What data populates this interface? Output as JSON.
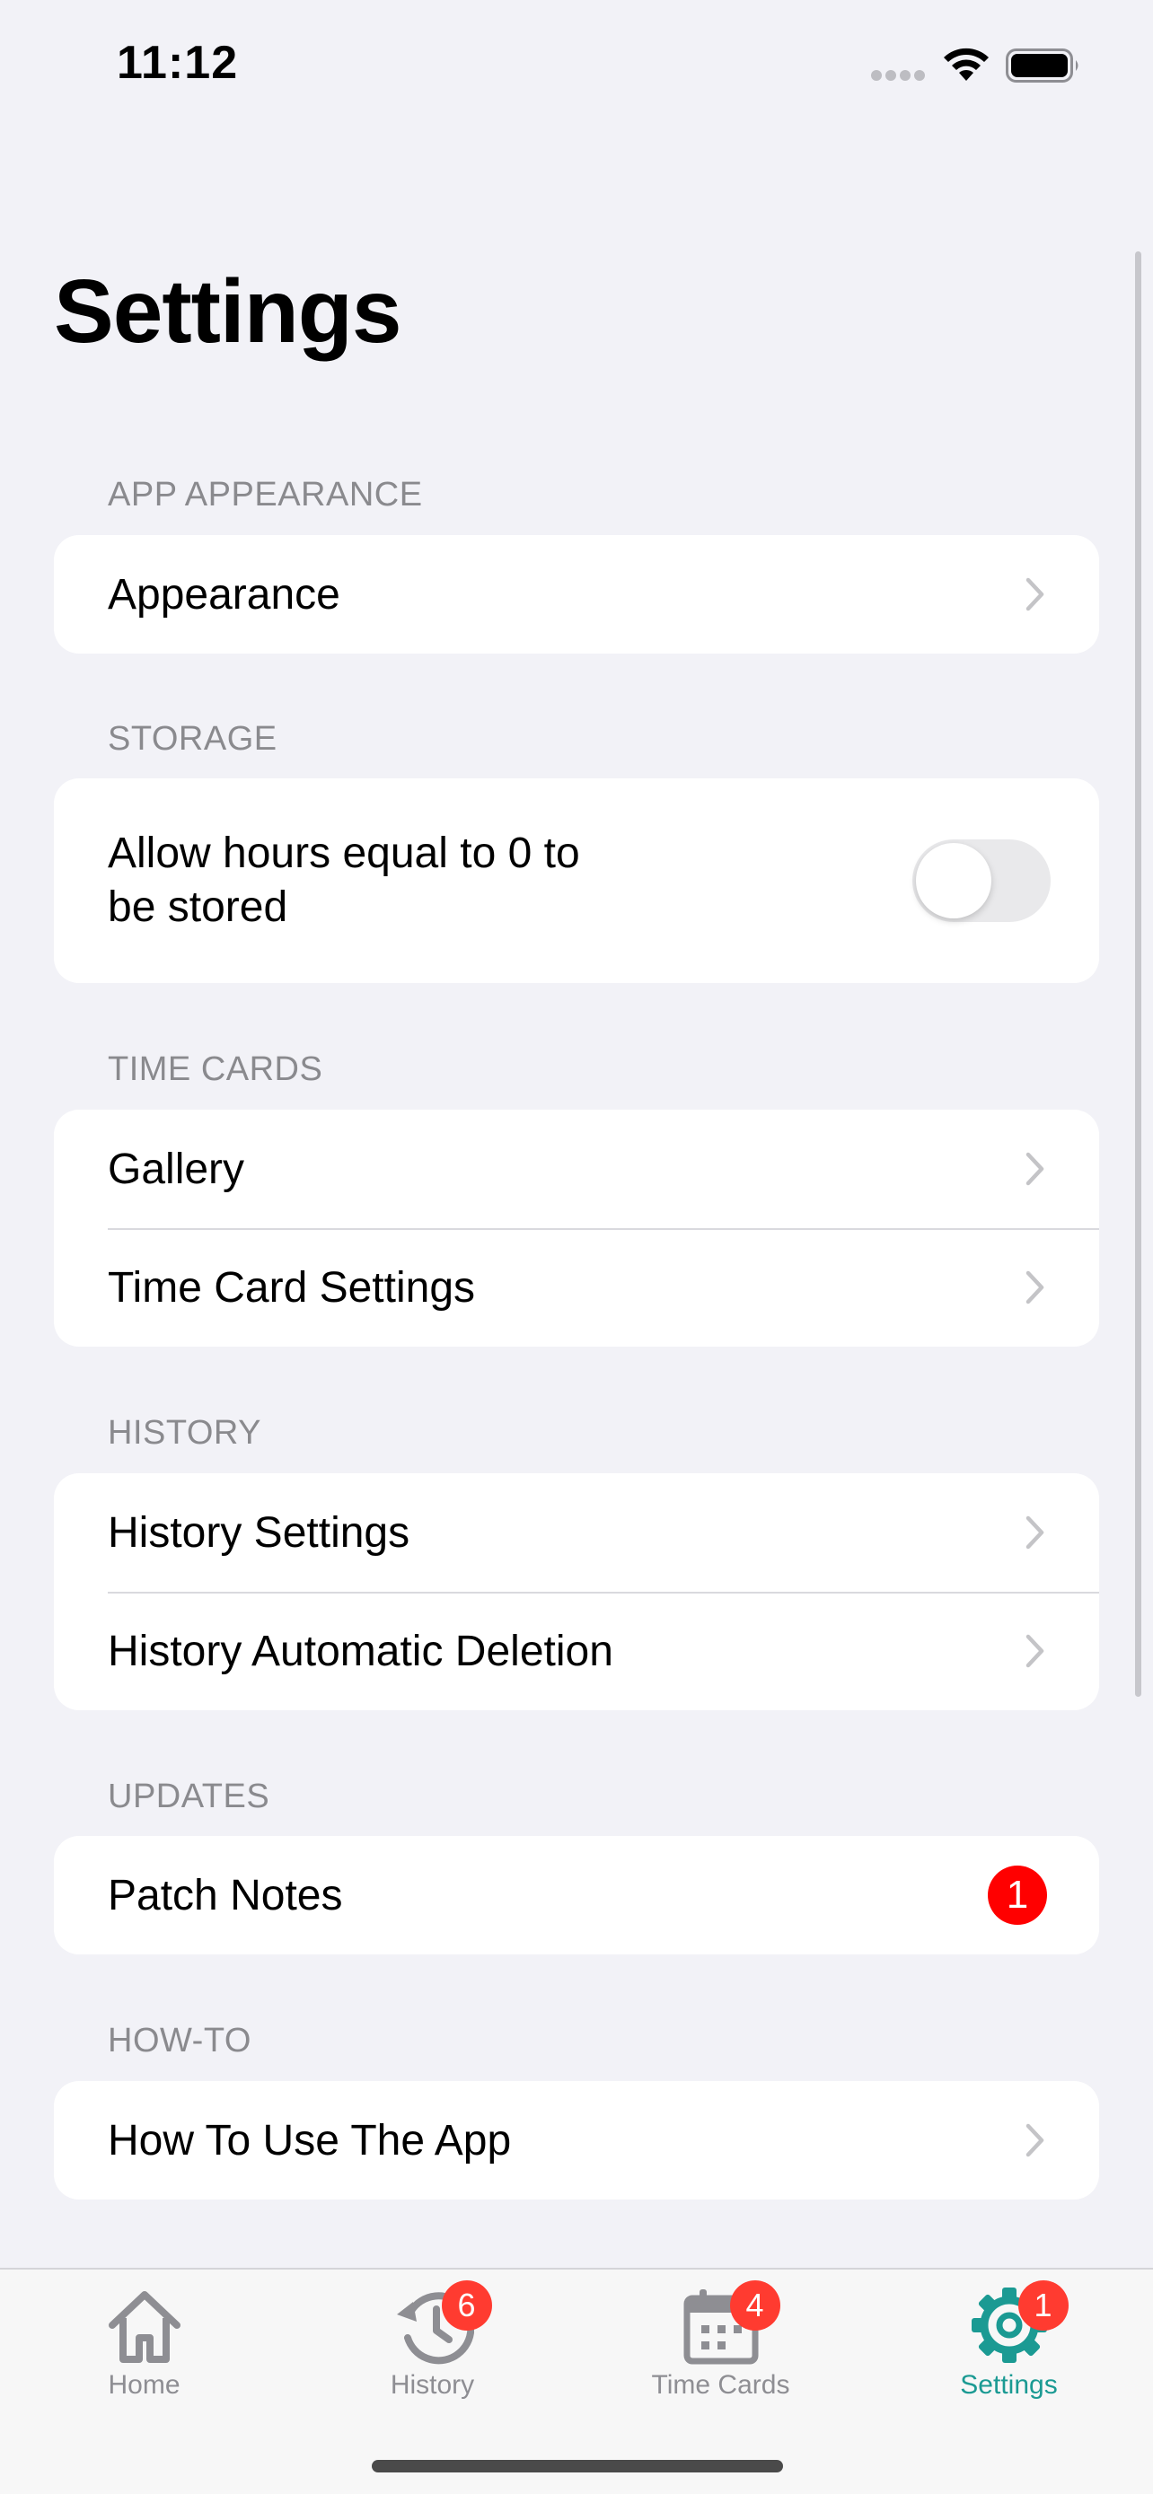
{
  "status_bar": {
    "time": "11:12"
  },
  "page": {
    "title": "Settings"
  },
  "sections": {
    "appearance": {
      "header": "APP APPEARANCE",
      "row_label": "Appearance"
    },
    "storage": {
      "header": "STORAGE",
      "row_label_line1": "Allow hours equal to 0 to",
      "row_label_line2": "be stored",
      "toggle_on": false
    },
    "time_cards": {
      "header": "TIME CARDS",
      "gallery_label": "Gallery",
      "settings_label": "Time Card Settings"
    },
    "history": {
      "header": "HISTORY",
      "settings_label": "History Settings",
      "deletion_label": "History Automatic Deletion"
    },
    "updates": {
      "header": "UPDATES",
      "patch_notes_label": "Patch Notes",
      "patch_notes_badge": "1"
    },
    "how_to": {
      "header": "HOW-TO",
      "row_label": "How To Use The App"
    }
  },
  "tab_bar": {
    "home": {
      "label": "Home",
      "icon": "house-icon"
    },
    "history": {
      "label": "History",
      "icon": "history-clock-icon",
      "badge": "6"
    },
    "time_cards": {
      "label": "Time Cards",
      "icon": "calendar-icon",
      "badge": "4"
    },
    "settings": {
      "label": "Settings",
      "icon": "gear-icon",
      "badge": "1",
      "active": true
    }
  },
  "colors": {
    "accent": "#1b9a93",
    "badge": "#ff3b30",
    "background": "#f2f2f7"
  }
}
